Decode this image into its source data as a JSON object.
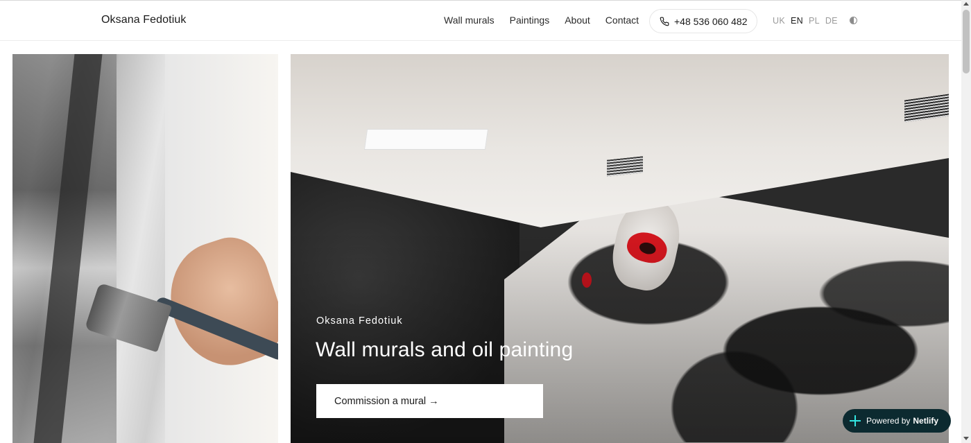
{
  "header": {
    "brand": "Oksana Fedotiuk",
    "nav": [
      {
        "label": "Wall murals"
      },
      {
        "label": "Paintings"
      },
      {
        "label": "About"
      },
      {
        "label": "Contact"
      }
    ],
    "phone": "+48 536 060 482",
    "phone_icon": "phone-icon",
    "languages": [
      {
        "code": "UK",
        "active": false
      },
      {
        "code": "EN",
        "active": true
      },
      {
        "code": "PL",
        "active": false
      },
      {
        "code": "DE",
        "active": false
      }
    ],
    "theme_icon": "contrast-icon"
  },
  "hero": {
    "eyebrow": "Oksana Fedotiuk",
    "title": "Wall murals and oil painting",
    "cta_label": "Commission a mural →"
  },
  "badge": {
    "prefix": "Powered by",
    "brand": "Netlify"
  },
  "colors": {
    "badge_bg": "#0c2a30",
    "badge_icon": "#32e6e2",
    "lips": "#d3171f"
  }
}
